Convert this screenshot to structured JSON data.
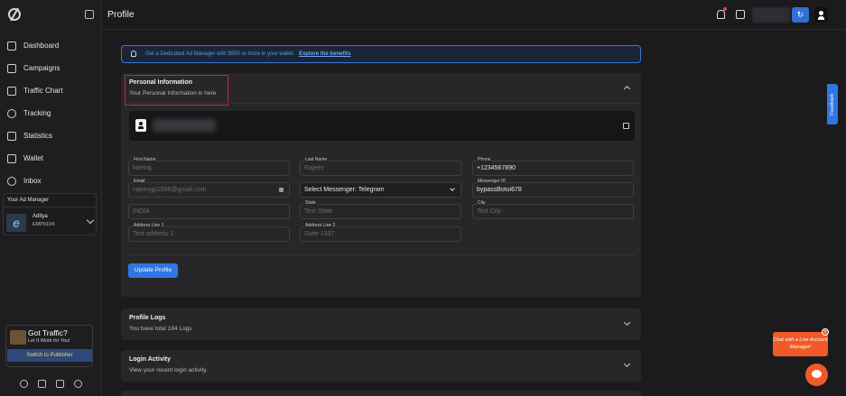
{
  "header": {
    "page_title": "Profile"
  },
  "sidebar": {
    "items": [
      {
        "label": "Dashboard",
        "icon": "home-icon"
      },
      {
        "label": "Campaigns",
        "icon": "campaigns-icon"
      },
      {
        "label": "Traffic Chart",
        "icon": "chart-icon"
      },
      {
        "label": "Tracking",
        "icon": "tracking-icon"
      },
      {
        "label": "Statistics",
        "icon": "statistics-icon"
      },
      {
        "label": "Wallet",
        "icon": "wallet-icon"
      },
      {
        "label": "Inbox",
        "icon": "inbox-icon"
      }
    ],
    "ad_manager": {
      "title": "Your Ad Manager",
      "name": "Aditya",
      "code": "EMP9104"
    },
    "promo": {
      "title": "Got Traffic?",
      "subtitle": "Let It Work for You!",
      "button": "Switch to Publisher"
    }
  },
  "banner": {
    "text": "Get a Dedicated Ad Manager with $500 or more in your wallet.",
    "link": "Explore the benefits"
  },
  "personal_info": {
    "title": "Personal Information",
    "subtitle": "Your Personal Information is here",
    "fields": {
      "first_name": {
        "label": "First Name",
        "value": "Neeraj"
      },
      "last_name": {
        "label": "Last Name",
        "value": "Rajeev"
      },
      "phone": {
        "label": "Phone",
        "value": "+1234567890"
      },
      "email": {
        "label": "Email",
        "value": "rajeevgp1596@gmail.com"
      },
      "messenger": {
        "value": "Select Messenger: Telegram"
      },
      "messenger_id": {
        "label": "Messenger ID",
        "value": "bypassBotui678"
      },
      "country": {
        "value": "INDIA"
      },
      "state": {
        "label": "State",
        "value": "Test State"
      },
      "city": {
        "label": "City",
        "value": "Test City"
      },
      "address1": {
        "label": "Address Line 1",
        "value": "Test address 1"
      },
      "address2": {
        "label": "Address Line 2",
        "value": "Suite 1337"
      }
    },
    "update_button": "Update Profile"
  },
  "profile_logs": {
    "title": "Profile Logs",
    "subtitle": "You have total 184 Logs"
  },
  "login_activity": {
    "title": "Login Activity",
    "subtitle": "View your recent login activity."
  },
  "feedback": {
    "label": "Feedback"
  },
  "chat": {
    "bubble": "Chat with a Live Account Manager!",
    "close": "x"
  },
  "colors": {
    "accent": "#2f77e3",
    "chat": "#f05a28",
    "highlight": "#d0262b"
  }
}
